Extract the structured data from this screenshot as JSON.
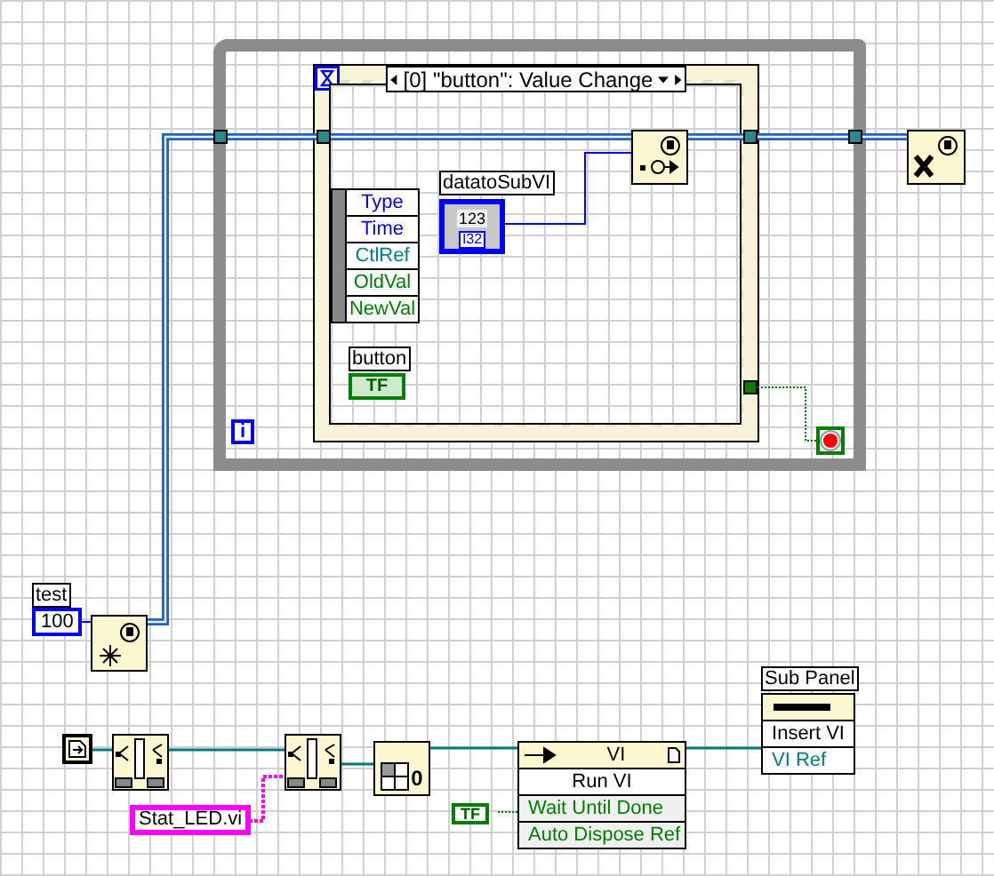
{
  "while_loop": {
    "iteration_label": "i"
  },
  "event_structure": {
    "case_selector": "[0] \"button\": Value Change",
    "event_data": [
      {
        "label": "Type",
        "color": "#0000ff"
      },
      {
        "label": "Time",
        "color": "#0000ff"
      },
      {
        "label": "CtlRef",
        "color": "#008080"
      },
      {
        "label": "OldVal",
        "color": "#008000"
      },
      {
        "label": "NewVal",
        "color": "#008000"
      }
    ],
    "terminals": [
      {
        "label": "datatoSubVI",
        "value": "123",
        "type": "I32",
        "kind": "numeric"
      },
      {
        "label": "button",
        "type": "TF",
        "kind": "boolean"
      }
    ]
  },
  "test_control": {
    "label": "test",
    "value": "100"
  },
  "string_constant": "Stat_LED.vi",
  "array_constant": "0",
  "false_constant": "TF",
  "run_vi_node": {
    "header": "VI",
    "method": "Run VI",
    "params": [
      "Wait Until Done",
      "Auto Dispose Ref"
    ]
  },
  "sub_panel_node": {
    "label": "Sub Panel",
    "method": "Insert VI",
    "params": [
      "VI Ref"
    ]
  }
}
